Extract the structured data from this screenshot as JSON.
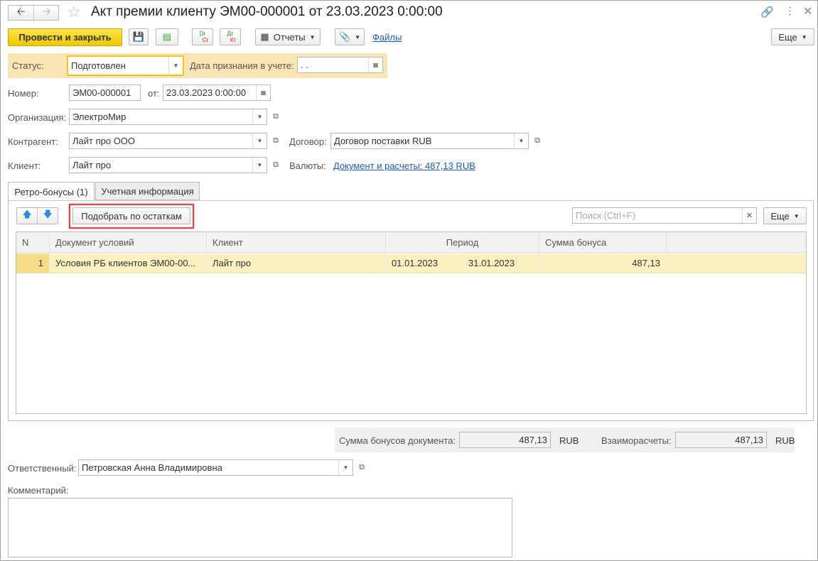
{
  "title": "Акт премии клиенту ЭМ00-000001 от 23.03.2023 0:00:00",
  "toolbar": {
    "post_close": "Провести и закрыть",
    "reports": "Отчеты",
    "files": "Файлы",
    "more": "Еще",
    "dr": "Dr",
    "cr": "Cr",
    "dt": "Дт",
    "kt": "Кт"
  },
  "status": {
    "label": "Статус:",
    "value": "Подготовлен",
    "date_label": "Дата признания в учете:",
    "date_value": " .  ."
  },
  "number": {
    "label": "Номер:",
    "value": "ЭМ00-000001",
    "from_label": "от:",
    "date": "23.03.2023  0:00:00"
  },
  "org": {
    "label": "Организация:",
    "value": "ЭлектроМир"
  },
  "contractor": {
    "label": "Контрагент:",
    "value": "Лайт про ООО",
    "contract_label": "Договор:",
    "contract_value": "Договор поставки RUB"
  },
  "client": {
    "label": "Клиент:",
    "value": "Лайт про",
    "currency_label": "Валюты:",
    "currency_link": "Документ и расчеты: 487,13 RUB"
  },
  "tabs": [
    {
      "label": "Ретро-бонусы (1)"
    },
    {
      "label": "Учетная информация"
    }
  ],
  "table_toolbar": {
    "pick": "Подобрать по остаткам",
    "search_placeholder": "Поиск (Ctrl+F)",
    "more": "Еще"
  },
  "table": {
    "headers": [
      "N",
      "Документ условий",
      "Клиент",
      "Период",
      "Сумма бонуса"
    ],
    "rows": [
      {
        "n": "1",
        "doc": "Условия РБ клиентов ЭМ00-00...",
        "client": "Лайт про",
        "from": "01.01.2023",
        "to": "31.01.2023",
        "sum": "487,13"
      }
    ]
  },
  "totals": {
    "bonus_label": "Сумма бонусов документа:",
    "bonus_value": "487,13",
    "bonus_cur": "RUB",
    "settle_label": "Взаиморасчеты:",
    "settle_value": "487,13",
    "settle_cur": "RUB"
  },
  "responsible": {
    "label": "Ответственный:",
    "value": "Петровская Анна Владимировна"
  },
  "comment": {
    "label": "Комментарий:",
    "value": ""
  }
}
